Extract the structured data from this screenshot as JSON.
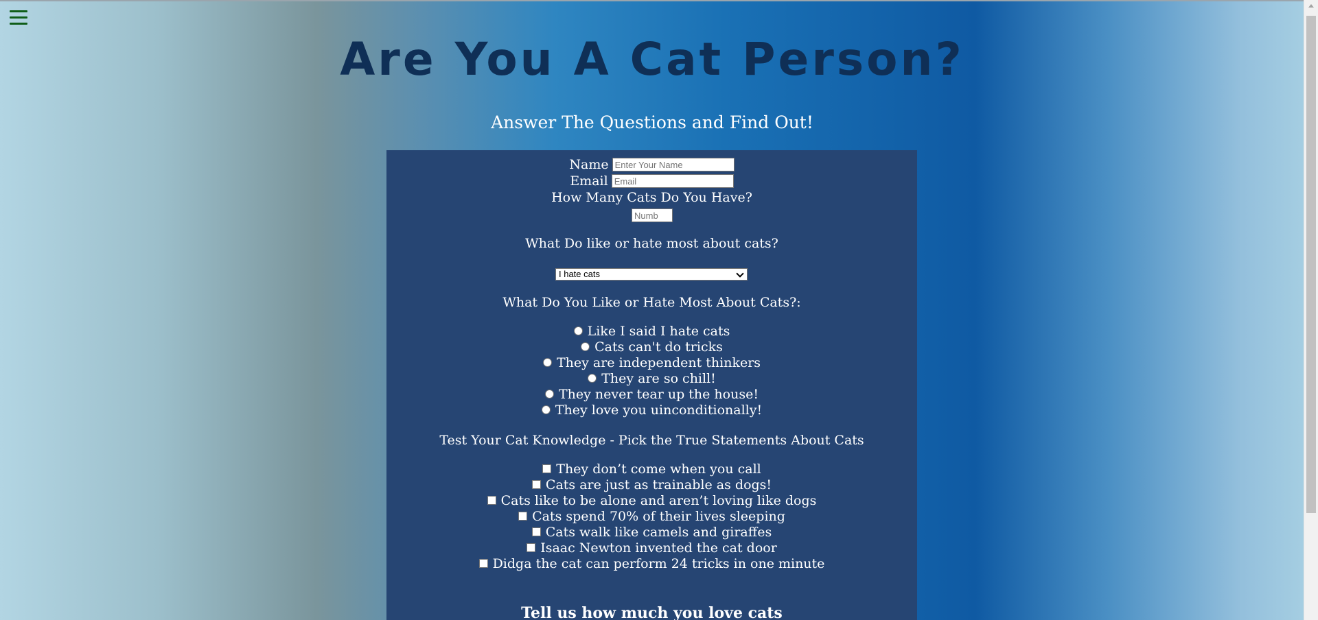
{
  "page": {
    "title": "Are You A Cat Person?",
    "subtitle": "Answer The Questions and Find Out!"
  },
  "form": {
    "name_label": "Name",
    "name_placeholder": "Enter Your Name",
    "email_label": "Email",
    "email_placeholder": "Email",
    "cats_question": "How Many Cats Do You Have?",
    "cats_placeholder": "Numb",
    "dropdown_question": "What Do like or hate most about cats?",
    "dropdown_selected": "I hate cats",
    "radio_question": "What Do You Like or Hate Most About Cats?:",
    "radio_options": [
      "Like I said I hate cats",
      "Cats can't do tricks",
      "They are independent thinkers",
      "They are so chill!",
      "They never tear up the house!",
      "They love you uinconditionally!"
    ],
    "checkbox_question": "Test Your Cat Knowledge - Pick the True Statements About Cats",
    "checkbox_options": [
      "They don’t come when you call",
      "Cats are just as trainable as dogs!",
      "Cats like to be alone and aren’t loving like dogs",
      "Cats spend 70% of their lives sleeping",
      "Cats walk like camels and giraffes",
      "Isaac Newton invented the cat door",
      "Didga the cat can perform 24 tricks in one minute"
    ],
    "love_heading": "Tell us how much you love cats"
  },
  "icons": {
    "menu": "hamburger-menu-icon"
  },
  "colors": {
    "title": "#0f2f56",
    "panel": "#264573",
    "menu_icon": "#0f5d18"
  }
}
